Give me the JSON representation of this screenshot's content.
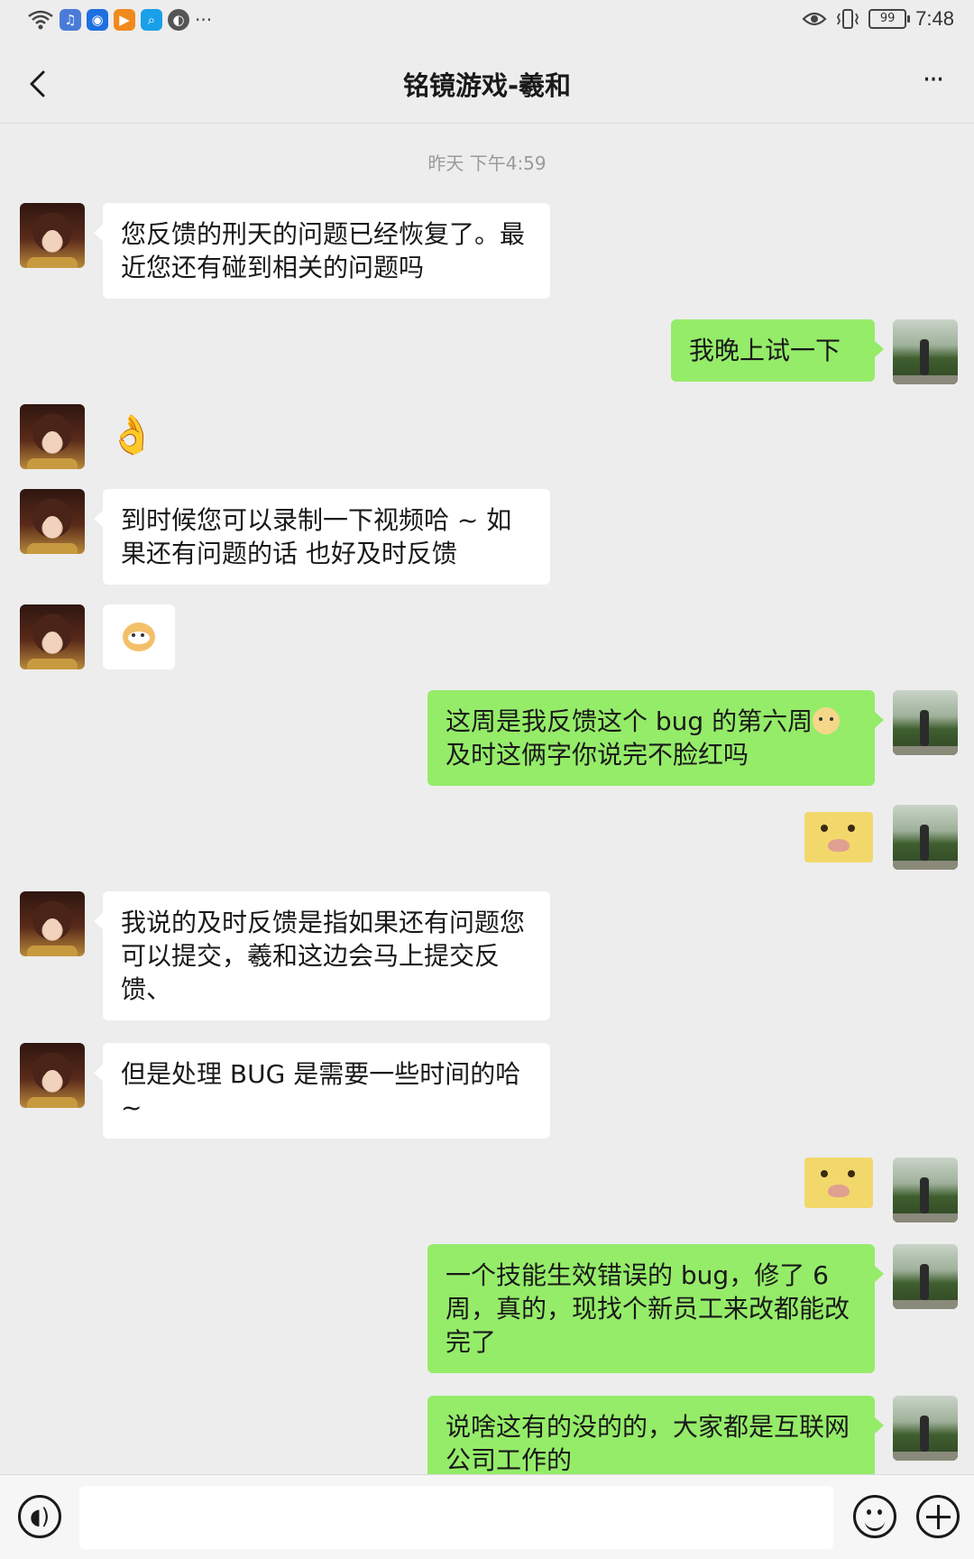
{
  "status_bar": {
    "time": "7:48",
    "battery": "99",
    "more_indicator": "···",
    "icons": [
      "wifi-icon",
      "music-app-icon",
      "bulb-app-icon",
      "play-app-icon",
      "search-app-icon",
      "ball-app-icon",
      "eye-icon",
      "vibrate-icon",
      "battery-icon"
    ]
  },
  "header": {
    "title": "铭镜游戏-羲和",
    "back_icon": "chevron-left-icon",
    "more_icon": "more-dots-icon",
    "more_glyph": "···"
  },
  "chat": {
    "timestamp": "昨天 下午4:59",
    "messages": [
      {
        "side": "in",
        "type": "text",
        "text": "您反馈的刑天的问题已经恢复了。最近您还有碰到相关的问题吗"
      },
      {
        "side": "out",
        "type": "text",
        "text": "我晚上试一下"
      },
      {
        "side": "in",
        "type": "emoji",
        "emoji": "ok-hand-emoji",
        "glyph": "👌"
      },
      {
        "side": "in",
        "type": "text",
        "text": "到时候您可以录制一下视频哈 ~ 如果还有问题的话 也好及时反馈"
      },
      {
        "side": "in",
        "type": "sticker",
        "sticker": "doge-emoji"
      },
      {
        "side": "out",
        "type": "text",
        "text_line1": "这周是我反馈这个 bug 的第六周",
        "text_line2": "及时这俩字你说完不脸红吗"
      },
      {
        "side": "out",
        "type": "sticker",
        "sticker": "awkward-meme"
      },
      {
        "side": "in",
        "type": "text",
        "text": "我说的及时反馈是指如果还有问题您可以提交，羲和这边会马上提交反馈、"
      },
      {
        "side": "in",
        "type": "text",
        "text": "但是处理 BUG 是需要一些时间的哈 ~"
      },
      {
        "side": "out",
        "type": "sticker",
        "sticker": "awkward-meme"
      },
      {
        "side": "out",
        "type": "text",
        "text": "一个技能生效错误的 bug，修了 6 周，真的，现找个新员工来改都能改完了"
      },
      {
        "side": "out",
        "type": "text",
        "text": "说啥这有的没的的，大家都是互联网公司工作的"
      }
    ]
  },
  "input_bar": {
    "voice_icon": "voice-icon",
    "voice_glyph": "◖)",
    "emoji_icon": "smiley-icon",
    "plus_icon": "plus-icon",
    "input_value": ""
  }
}
